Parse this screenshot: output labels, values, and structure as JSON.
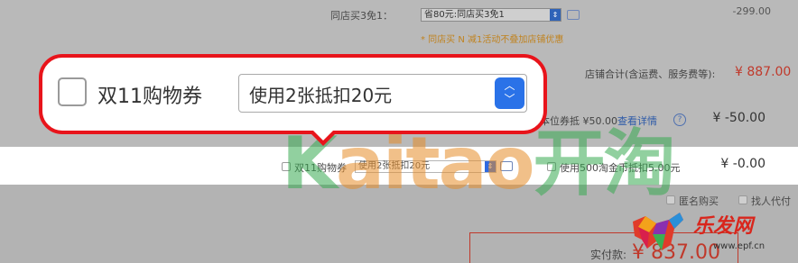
{
  "order": {
    "promo_label": "同店买3免1：",
    "promo_select_value": "省80元:同店买3免1",
    "promo_amount": "-299.00",
    "promo_note": "* 同店买 N 减1活动不叠加店铺优惠",
    "shop_total_label": "店铺合计(含运费、服务费等):",
    "shop_total_value": "¥ 887.00",
    "coupon_line_prefix": "本位券抵 ¥50.00",
    "coupon_link": "查看详情",
    "coupon_amount": "¥ -50.00"
  },
  "highlight_row": {
    "double11_label": "双11购物券",
    "double11_select_value": "使用2张抵扣20元",
    "taojinbi_label": "使用500淘金币抵扣5.00元",
    "amount": "¥ -0.00"
  },
  "footer": {
    "anonymous_label": "匿名购买",
    "proxy_label": "找人代付",
    "pay_label": "实付款:",
    "pay_value": "¥ 837.00"
  },
  "callout": {
    "checkbox_label": "双11购物券",
    "select_value": "使用2张抵扣20元",
    "spin_up": "︿",
    "spin_down": "﹀"
  },
  "watermark": {
    "latin_k": "K",
    "latin_rest": "aitao",
    "cn": "开淘"
  },
  "logo": {
    "text": "乐发网",
    "url": "www.epf.cn"
  },
  "icons": {
    "spinner": "⇕",
    "help": "?"
  },
  "colors": {
    "accent_red": "#e8141b",
    "blue_spin": "#2a72e8",
    "price_red": "#c0392b"
  }
}
